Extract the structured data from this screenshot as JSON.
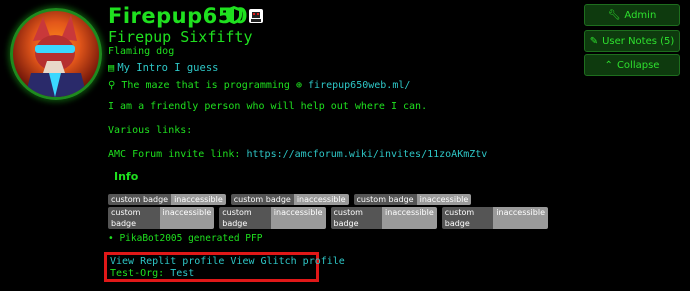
{
  "profile": {
    "username": "Firepup650",
    "full_name": "Firepup Sixfifty",
    "title": "Flaming dog",
    "bio_link": "My Intro I guess",
    "location": "The maze that is programming",
    "website": "firepup650web.ml/"
  },
  "bio": {
    "line1": "I am a friendly person who will help out where I can.",
    "line2": "Various links:",
    "amc_label": "AMC Forum invite link: ",
    "amc_url": "https://amcforum.wiki/invites/11zoAKmZtv"
  },
  "info": {
    "heading": "Info",
    "badge_label": "custom badge",
    "badge_value": "inaccessible",
    "bullet": "PikaBot2005 generated PFP"
  },
  "links": {
    "replit": "View Replit profile",
    "glitch": "View Glitch profile",
    "org_label": "Test-Org:",
    "org_value": "Test"
  },
  "actions": {
    "admin": "Admin",
    "user_notes": "User Notes (5)",
    "collapse": "Collapse"
  },
  "icons": {
    "shield": "shield-icon",
    "flair": "flair-icon",
    "book": "book-icon",
    "location": "map-pin-icon",
    "globe": "globe-icon",
    "wrench": "wrench-icon",
    "pencil": "pencil-icon",
    "collapse": "double-chevron-up-icon"
  },
  "colors": {
    "background": "#000000",
    "accent": "#1fe01f",
    "link": "#2ec7c7",
    "highlight": "#e01818"
  }
}
